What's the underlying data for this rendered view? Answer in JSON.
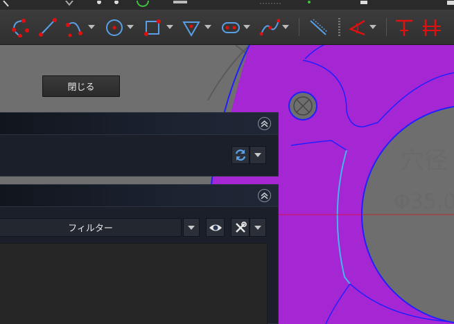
{
  "toolbar": {
    "tools": [
      {
        "name": "arc-tool",
        "icon": "arc-icon"
      },
      {
        "name": "line-tool",
        "icon": "line-icon"
      },
      {
        "name": "arc-3point-tool",
        "icon": "arc-3point-icon"
      },
      {
        "name": "circle-tool",
        "icon": "circle-icon"
      },
      {
        "name": "rectangle-tool",
        "icon": "rectangle-icon"
      },
      {
        "name": "polygon-tool",
        "icon": "polygon-icon"
      },
      {
        "name": "slot-tool",
        "icon": "slot-icon"
      },
      {
        "name": "bspline-tool",
        "icon": "bspline-icon"
      },
      {
        "name": "construction-toggle-tool",
        "icon": "construction-icon"
      },
      {
        "name": "angle-constraint-tool",
        "icon": "angle-constraint-icon"
      },
      {
        "name": "vertical-constraint-tool",
        "icon": "vertical-constraint-icon"
      },
      {
        "name": "horizontal-constraint-tool",
        "icon": "horizontal-constraint-icon"
      }
    ]
  },
  "dialog": {
    "close_label": "閉じる"
  },
  "panel2": {
    "filter_label": "フィルター"
  },
  "canvas": {
    "label_line1": "穴径",
    "label_line2": "Φ35.0"
  },
  "colors": {
    "face": "#a526d3",
    "edge": "#1f1fff",
    "highlight_edge": "#41b7ea",
    "constraint_red": "#e01010",
    "accent_blue": "#5aa0e6"
  }
}
